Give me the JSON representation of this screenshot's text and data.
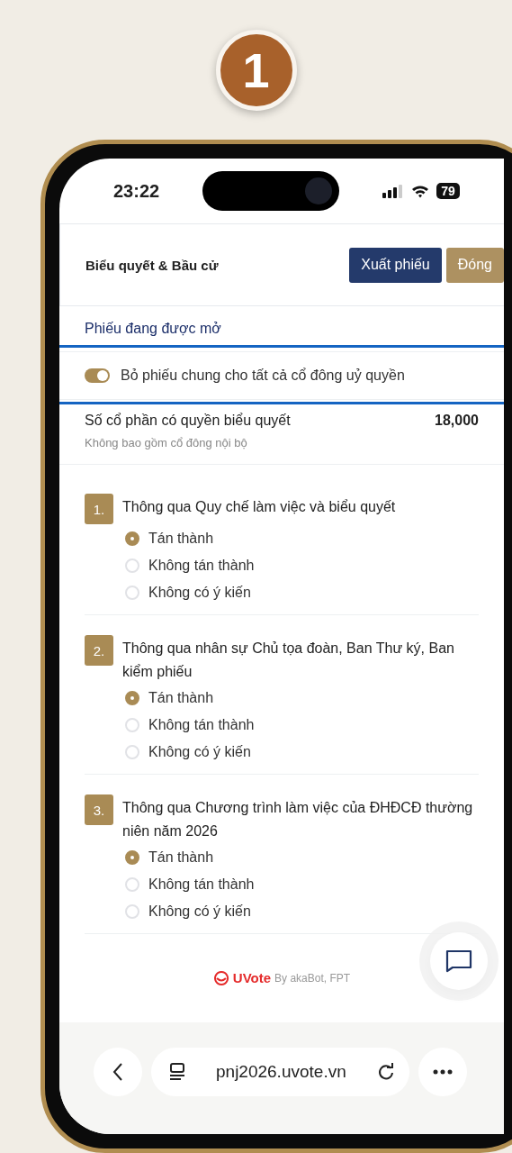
{
  "step_badge": "1",
  "status_bar": {
    "time": "23:22",
    "battery": "79"
  },
  "header": {
    "title": "Biểu quyết & Bầu cử",
    "buttons": [
      {
        "label": "Xuất phiếu",
        "kind": "primary"
      },
      {
        "label": "Đóng",
        "kind": "secondary"
      }
    ]
  },
  "section_link": "Phiếu đang được mở",
  "toggle": {
    "label": "Bỏ phiếu chung cho tất cả cổ đông uỷ quyền",
    "on": true
  },
  "shares": {
    "label": "Số cổ phần có quyền biểu quyết",
    "value": "18,000",
    "note": "Không bao gồm cổ đông nội bộ"
  },
  "resolutions": [
    {
      "number": "1.",
      "title": "Thông qua Quy chế làm việc và biểu quyết",
      "options": [
        {
          "label": "Tán thành",
          "selected": true
        },
        {
          "label": "Không tán thành",
          "selected": false
        },
        {
          "label": "Không có ý kiến",
          "selected": false
        }
      ]
    },
    {
      "number": "2.",
      "title": "Thông qua nhân sự Chủ tọa đoàn, Ban Thư ký, Ban kiểm phiếu",
      "options": [
        {
          "label": "Tán thành",
          "selected": true
        },
        {
          "label": "Không tán thành",
          "selected": false
        },
        {
          "label": "Không có ý kiến",
          "selected": false
        }
      ]
    },
    {
      "number": "3.",
      "title": "Thông qua Chương trình làm việc của ĐHĐCĐ thường niên năm 2026",
      "options": [
        {
          "label": "Tán thành",
          "selected": true
        },
        {
          "label": "Không tán thành",
          "selected": false
        },
        {
          "label": "Không có ý kiến",
          "selected": false
        }
      ]
    }
  ],
  "footer": {
    "brand": "UVote",
    "credit": "By akaBot, FPT"
  },
  "browser": {
    "url": "pnj2026.uvote.vn"
  }
}
